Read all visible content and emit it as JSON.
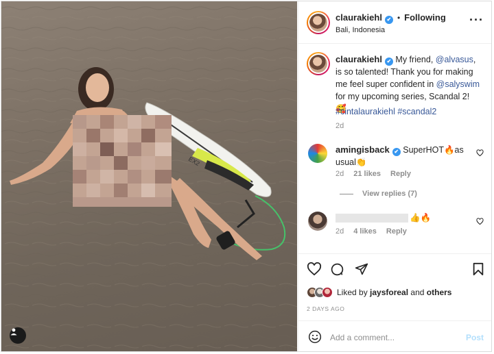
{
  "colors": {
    "accent": "#3897f0",
    "link": "#385898",
    "muted": "#8e8e8e",
    "post_disabled": "#b2dffc",
    "text": "#262626"
  },
  "header": {
    "username": "claurakiehl",
    "follow_status": "Following",
    "location": "Bali, Indonesia",
    "separator": "•",
    "more_icon": "more-options-icon",
    "verified_mark": "✔"
  },
  "caption": {
    "username": "claurakiehl",
    "text_parts": {
      "p1": "My friend, ",
      "m1": "@alvasus",
      "p2": ", is so talented! Thank you for making me feel super confident in ",
      "m2": "@salyswim",
      "p3": " for my upcoming series, Scandal 2! 🥰"
    },
    "hashtags": "#cintalaurakiehl #scandal2",
    "time": "2d"
  },
  "comments": [
    {
      "username": "amingisback",
      "text": "SuperHOT🔥as usual👏",
      "time": "2d",
      "likes": "21 likes",
      "reply": "Reply",
      "view_replies": "View replies (7)"
    },
    {
      "username": "",
      "text": "👍🔥",
      "time": "2d",
      "likes": "4 likes",
      "reply": "Reply"
    }
  ],
  "actions": {
    "liked_by_prefix": "Liked by ",
    "liked_by_user": "jaysforeal",
    "liked_by_and": " and ",
    "liked_by_others": "others",
    "time_ago": "2 DAYS AGO"
  },
  "add_comment": {
    "placeholder": "Add a comment...",
    "post_label": "Post"
  }
}
